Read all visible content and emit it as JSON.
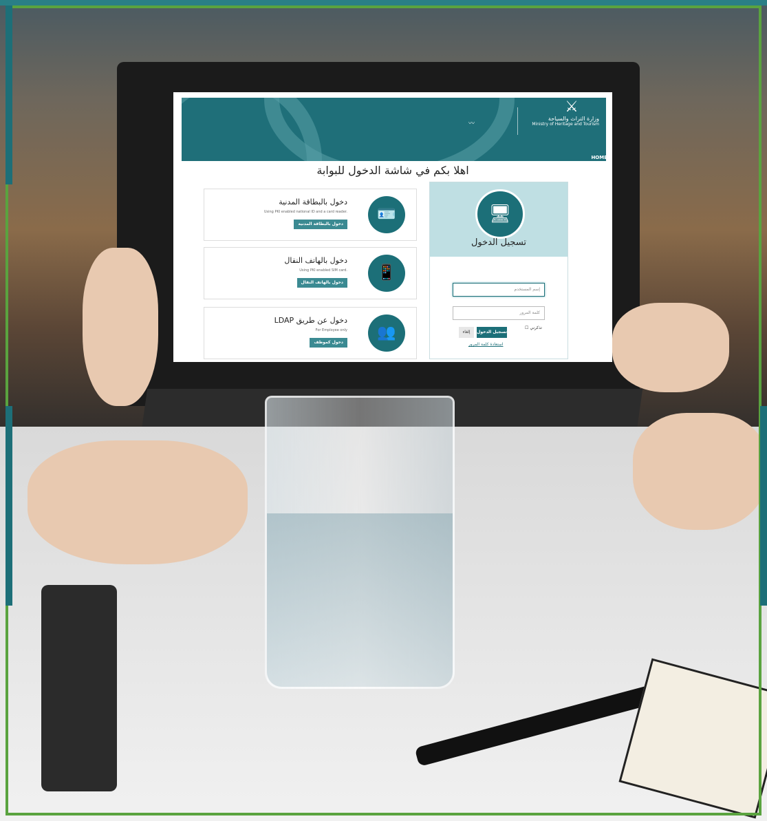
{
  "banner": {
    "ministry_ar": "وزارة التراث والسياحة",
    "ministry_en": "Ministry of Heritage and Tourism",
    "emblem_icon": "oman-emblem-icon",
    "home_label": "HOME",
    "accent_color": "#1f6f79"
  },
  "welcome_text": "اهلا بكم في شاشة الدخول للبوابة",
  "login": {
    "title": "تسجيل الدخول",
    "icon": "user-computer-icon",
    "username_placeholder": "إسم المستخدم",
    "password_placeholder": "كلمة المرور",
    "remember_label": "تذكرني",
    "login_button": "تسجيل الدخول",
    "cancel_button": "إلغاء",
    "forgot_link": "استعادة كلمة المرور"
  },
  "options": [
    {
      "title": "دخول بالبطاقة المدنية",
      "subtitle": "Using PKI enabled national ID and a card reader.",
      "button": "دخول بالبطاقة المدنية",
      "icon": "id-card-icon"
    },
    {
      "title": "دخول بالهاتف النقال",
      "subtitle": "Using PKI enabled SIM card.",
      "button": "دخول بالهاتف النقال",
      "icon": "mobile-phone-icon"
    },
    {
      "title": "دخول عن طريق LDAP",
      "subtitle": "For Employee only",
      "button": "دخول كموظف",
      "icon": "employees-network-icon"
    }
  ]
}
